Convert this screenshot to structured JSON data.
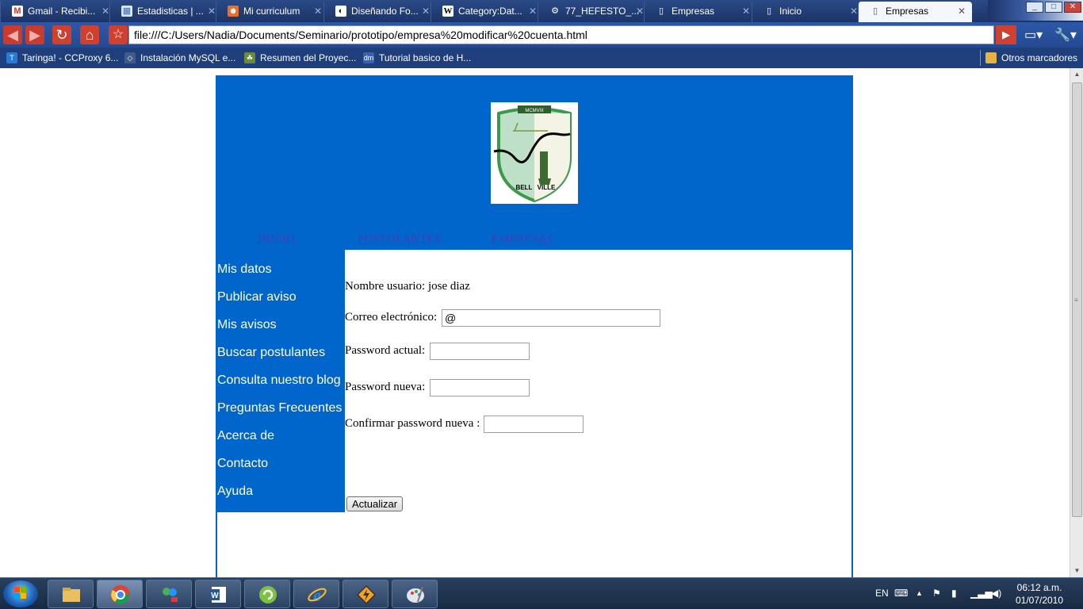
{
  "browser": {
    "tabs": [
      {
        "title": "Gmail - Recibi...",
        "icon": "gmail-icon",
        "icon_color": "#d93025",
        "glyph": "M"
      },
      {
        "title": "Estadisticas | ...",
        "icon": "stats-icon",
        "icon_color": "#3b6db5",
        "glyph": "▦"
      },
      {
        "title": "Mi curriculum",
        "icon": "person-icon",
        "icon_color": "#e8702a",
        "glyph": "☻"
      },
      {
        "title": "Diseñando Fo...",
        "icon": "site-icon",
        "icon_color": "#222222",
        "glyph": "◐"
      },
      {
        "title": "Category:Dat...",
        "icon": "wikipedia-icon",
        "icon_color": "#ffffff",
        "glyph": "W"
      },
      {
        "title": "77_HEFESTO_...",
        "icon": "document-icon",
        "icon_color": "#6b86b8",
        "glyph": "⚙"
      },
      {
        "title": "Empresas",
        "icon": "page-icon",
        "icon_color": "#ffffff",
        "glyph": "▯"
      },
      {
        "title": "Inicio",
        "icon": "page-icon",
        "icon_color": "#ffffff",
        "glyph": "▯"
      },
      {
        "title": "Empresas",
        "icon": "page-icon",
        "icon_color": "#ffffff",
        "glyph": "▯",
        "active": true
      }
    ],
    "address": "file:///C:/Users/Nadia/Documents/Seminario/prototipo/empresa%20modificar%20cuenta.html",
    "bookmarks": [
      {
        "label": "Taringa! - CCProxy 6...",
        "icon": "taringa-icon",
        "color": "#2a7ad5",
        "glyph": "T"
      },
      {
        "label": "Instalación MySQL e...",
        "icon": "mysql-icon",
        "color": "#3f5b87",
        "glyph": "◇"
      },
      {
        "label": "Resumen del Proyec...",
        "icon": "project-icon",
        "color": "#6a8b3a",
        "glyph": "☘"
      },
      {
        "label": "Tutorial basico de H...",
        "icon": "dm-icon",
        "color": "#3d62a8",
        "glyph": "dm"
      }
    ],
    "other_bookmarks": "Otros marcadores"
  },
  "site": {
    "crest_text_top": "MCMVIII",
    "crest_text_left": "BELL",
    "crest_text_right": "VILLE",
    "nav": [
      {
        "label": "INICIO"
      },
      {
        "label": "POSTULANTES"
      },
      {
        "label": "EMPRESAS"
      }
    ],
    "sidebar": [
      {
        "label": "Mis datos"
      },
      {
        "label": "Publicar aviso"
      },
      {
        "label": "Mis avisos"
      },
      {
        "label": "Buscar postulantes"
      },
      {
        "label": "Consulta nuestro blog"
      },
      {
        "label": "Preguntas Frecuentes"
      },
      {
        "label": "Acerca de"
      },
      {
        "label": "Contacto"
      },
      {
        "label": "Ayuda"
      }
    ],
    "form": {
      "username_label": "Nombre usuario: jose diaz",
      "email_label": "Correo electrónico:",
      "email_value": "@",
      "current_password_label": "Password actual:",
      "current_password_value": "",
      "new_password_label": "Password nueva:",
      "new_password_value": "",
      "confirm_password_label": "Confirmar password nueva :",
      "confirm_password_value": "",
      "submit_label": "Actualizar"
    },
    "colors": {
      "header_blue": "#0066cc",
      "link_purple": "#4a3bb0"
    }
  },
  "taskbar": {
    "apps": [
      {
        "name": "explorer-icon"
      },
      {
        "name": "chrome-icon",
        "active": true
      },
      {
        "name": "messenger-icon"
      },
      {
        "name": "word-icon"
      },
      {
        "name": "refresh-app-icon"
      },
      {
        "name": "internet-explorer-icon"
      },
      {
        "name": "winamp-icon"
      },
      {
        "name": "paint-icon"
      }
    ],
    "language": "EN",
    "time": "06:12 a.m.",
    "date": "01/07/2010"
  }
}
